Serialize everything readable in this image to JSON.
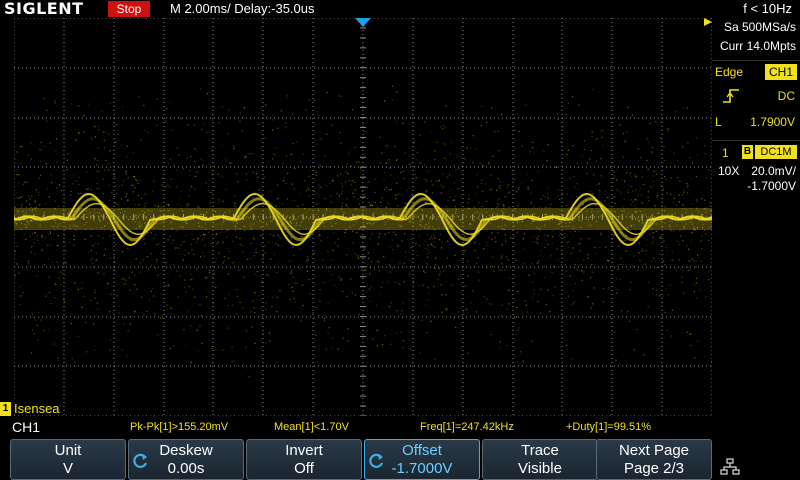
{
  "topbar": {
    "brand": "SIGLENT",
    "run_state": "Stop",
    "timebase": "M 2.00ms/ Delay:-35.0us",
    "trigger_frequency": "f < 10Hz"
  },
  "acquisition": {
    "sample_rate": "Sa 500MSa/s",
    "memory_depth": "Curr 14.0Mpts"
  },
  "trigger": {
    "type": "Edge",
    "source": "CH1",
    "slope_icon": "rising-edge-icon",
    "coupling": "DC",
    "level_label": "L",
    "level": "1.7900V"
  },
  "channel1": {
    "number": "1",
    "bw_limit_badge": "B",
    "coupling": "DC1M",
    "probe": "10X",
    "volts_per_div": "20.0mV/",
    "offset": "-1.7000V",
    "marker_label": "1",
    "label": "Isensea",
    "color": "#f0e020"
  },
  "measurements": {
    "channel": "CH1",
    "items": [
      "Pk-Pk[1]>155.20mV",
      "Mean[1]<1.70V",
      "Freq[1]=247.42kHz",
      "+Duty[1]=99.51%"
    ]
  },
  "menu": {
    "keys": [
      {
        "title": "Unit",
        "value": "V"
      },
      {
        "title": "Deskew",
        "value": "0.00s"
      },
      {
        "title": "Invert",
        "value": "Off"
      },
      {
        "title": "Offset",
        "value": "-1.7000V"
      },
      {
        "title": "Trace",
        "value": "Visible"
      },
      {
        "title": "Next Page",
        "value": "Page 2/3"
      }
    ],
    "network_icon": "network-icon"
  },
  "colors": {
    "waveform": "#f0e020",
    "run_state_bg": "#d01010",
    "grid": "#8a8a8a",
    "active_key": "#6ccfff",
    "trigger_marker": "#1ea0e8"
  }
}
